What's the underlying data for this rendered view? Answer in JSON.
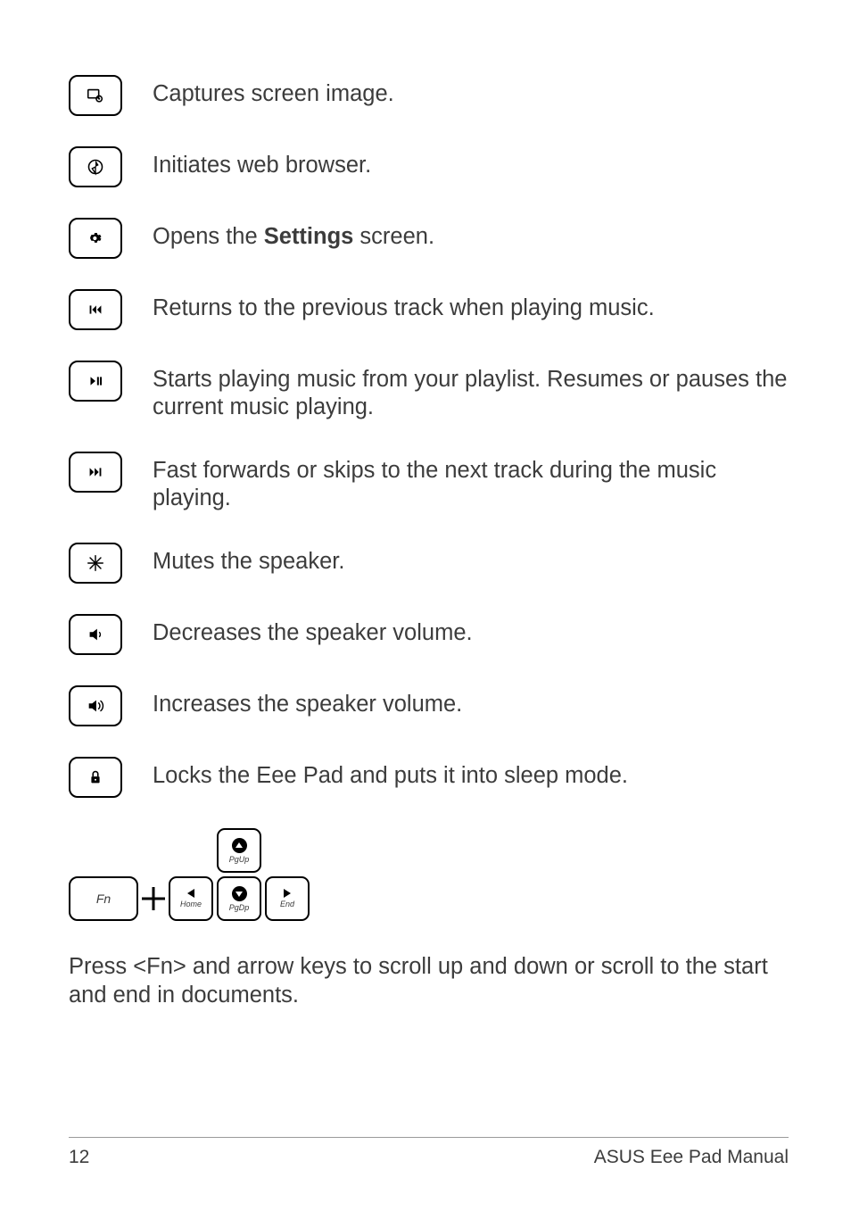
{
  "rows": [
    {
      "icon": "screenshot-icon",
      "desc": "Captures screen image."
    },
    {
      "icon": "browser-icon",
      "desc": "Initiates web browser."
    },
    {
      "icon": "settings-icon",
      "desc_html": "Opens the <strong>Settings</strong> screen."
    },
    {
      "icon": "previous-track-icon",
      "desc": "Returns to the previous track when playing music."
    },
    {
      "icon": "play-pause-icon",
      "desc": "Starts playing music from your playlist. Resumes or pauses the current music playing."
    },
    {
      "icon": "next-track-icon",
      "desc": "Fast forwards or skips to the next track during the music playing."
    },
    {
      "icon": "mute-icon",
      "desc": "Mutes the speaker."
    },
    {
      "icon": "volume-down-icon",
      "desc": "Decreases the speaker volume."
    },
    {
      "icon": "volume-up-icon",
      "desc": "Increases the speaker volume."
    },
    {
      "icon": "lock-icon",
      "desc": "Locks the Eee Pad and puts it into sleep mode."
    }
  ],
  "fn": {
    "fn_label": "Fn",
    "pgup": "PgUp",
    "home": "Home",
    "pgdp": "PgDp",
    "end": "End"
  },
  "paragraph": "Press <Fn> and arrow keys to scroll up and down or scroll to the start and end in documents.",
  "footer": {
    "page": "12",
    "manual": "ASUS Eee Pad Manual"
  }
}
